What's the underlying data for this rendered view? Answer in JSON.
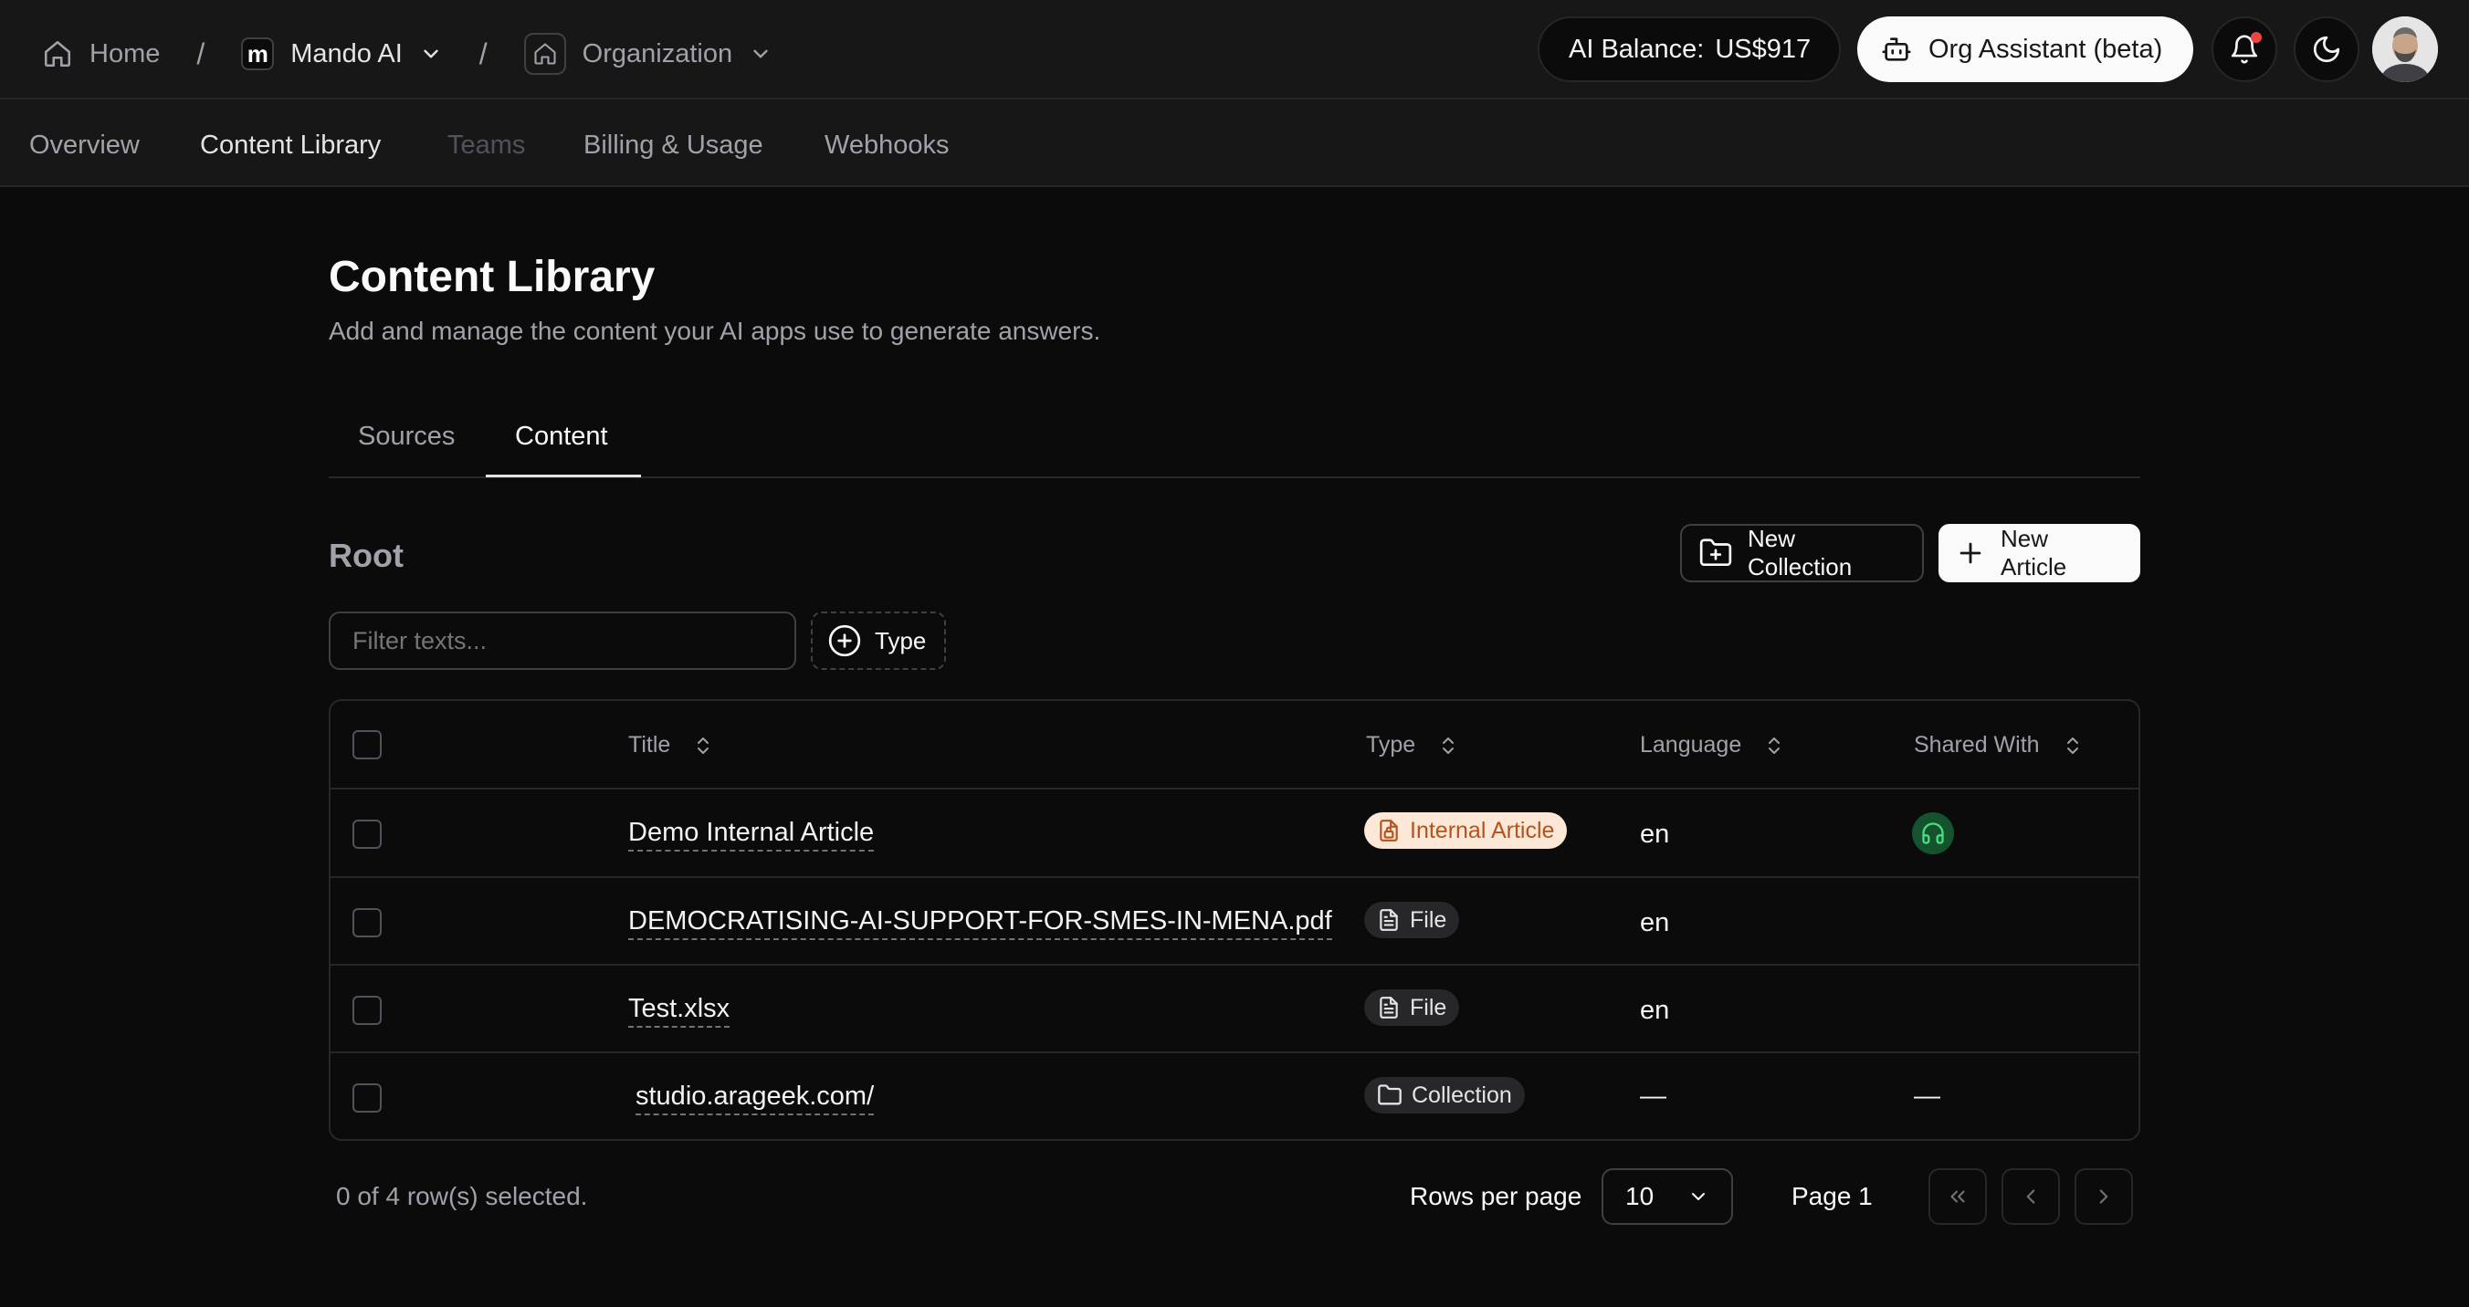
{
  "breadcrumb": {
    "home": "Home",
    "separator": "/",
    "workspace": "Mando AI",
    "workspace_logo_letter": "m",
    "section": "Organization"
  },
  "header": {
    "balance_label": "AI Balance:",
    "balance_value": "US$917",
    "assistant_button": "Org Assistant (beta)"
  },
  "subnav": {
    "items": [
      "Overview",
      "Content Library",
      "Teams",
      "Billing & Usage",
      "Webhooks"
    ],
    "active": "Content Library",
    "disabled": "Teams"
  },
  "page": {
    "title": "Content Library",
    "subtitle": "Add and manage the content your AI apps use to generate answers."
  },
  "tabs": [
    "Sources",
    "Content"
  ],
  "active_tab": "Content",
  "collection": {
    "title": "Root",
    "new_collection": "New Collection",
    "new_article": "New Article"
  },
  "filter": {
    "placeholder": "Filter texts...",
    "type_button": "Type"
  },
  "table": {
    "columns": [
      "Title",
      "Type",
      "Language",
      "Shared With"
    ],
    "rows": [
      {
        "title": "Demo Internal Article",
        "type": "Internal Article",
        "type_icon": "lock-file-icon",
        "language": "en",
        "shared_with_icon": "headset-icon"
      },
      {
        "title": "DEMOCRATISING-AI-SUPPORT-FOR-SMES-IN-MENA.pdf",
        "type": "File",
        "type_icon": "file-icon",
        "language": "en",
        "shared_with": ""
      },
      {
        "title": "Test.xlsx",
        "type": "File",
        "type_icon": "file-icon",
        "language": "en",
        "shared_with": ""
      },
      {
        "title": "studio.arageek.com/",
        "type": "Collection",
        "type_icon": "folder-icon",
        "language": "—",
        "shared_with": "—"
      }
    ]
  },
  "footer": {
    "selection": "0 of 4 row(s) selected.",
    "rows_per_page_label": "Rows per page",
    "rows_per_page_value": "10",
    "page_label": "Page 1"
  },
  "colors": {
    "background": "#0b0b0c",
    "bar": "#171717",
    "accent_badge_bg": "#fde7d6",
    "accent_badge_text": "#b4531e",
    "notification_dot": "#ef4444",
    "shared_icon": "#4ade80"
  }
}
